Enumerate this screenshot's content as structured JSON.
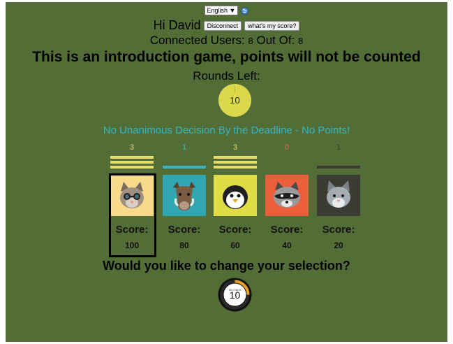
{
  "language": {
    "selected": "English ▼"
  },
  "header": {
    "greeting": "Hi David",
    "disconnect_label": "Disconnect",
    "score_label": "what's my score?",
    "connected_prefix": "Connected Users:",
    "connected_count": "8",
    "out_of_label": "Out Of:",
    "out_of_count": "8"
  },
  "intro_text": "This is an introduction game, points will not be counted",
  "rounds": {
    "label": "Rounds Left:",
    "value": "10"
  },
  "notice": "No Unanimous Decision By the Deadline - No Points!",
  "colors": {
    "background": "#536d36",
    "round_circle": "#dcd84b",
    "notice": "#35b5c2"
  },
  "cards": [
    {
      "animal": "cat-glasses-icon",
      "votes": "3",
      "vote_color": "#e5dc6c",
      "bars": 3,
      "tile_color": "#f9d98a",
      "score_label": "Score:",
      "score": "100",
      "selected": true
    },
    {
      "animal": "boar-icon",
      "votes": "1",
      "vote_color": "#35b5c2",
      "bars": 1,
      "tile_color": "#31a7b3",
      "score_label": "Score:",
      "score": "80",
      "selected": false
    },
    {
      "animal": "penguin-icon",
      "votes": "3",
      "vote_color": "#e5dc6c",
      "bars": 3,
      "tile_color": "#e0dc45",
      "score_label": "Score:",
      "score": "60",
      "selected": false
    },
    {
      "animal": "raccoon-icon",
      "votes": "0",
      "vote_color": "#f2613f",
      "bars": 0,
      "tile_color": "#ec5f3d",
      "score_label": "Score:",
      "score": "40",
      "selected": false
    },
    {
      "animal": "wolf-icon",
      "votes": "1",
      "vote_color": "#3b3b34",
      "bars": 1,
      "tile_color": "#3b3b34",
      "score_label": "Score:",
      "score": "20",
      "selected": false
    }
  ],
  "question": "Would you like to change your selection?",
  "timer": {
    "label": "SECONDS",
    "value": "10",
    "progress": 0.25
  }
}
